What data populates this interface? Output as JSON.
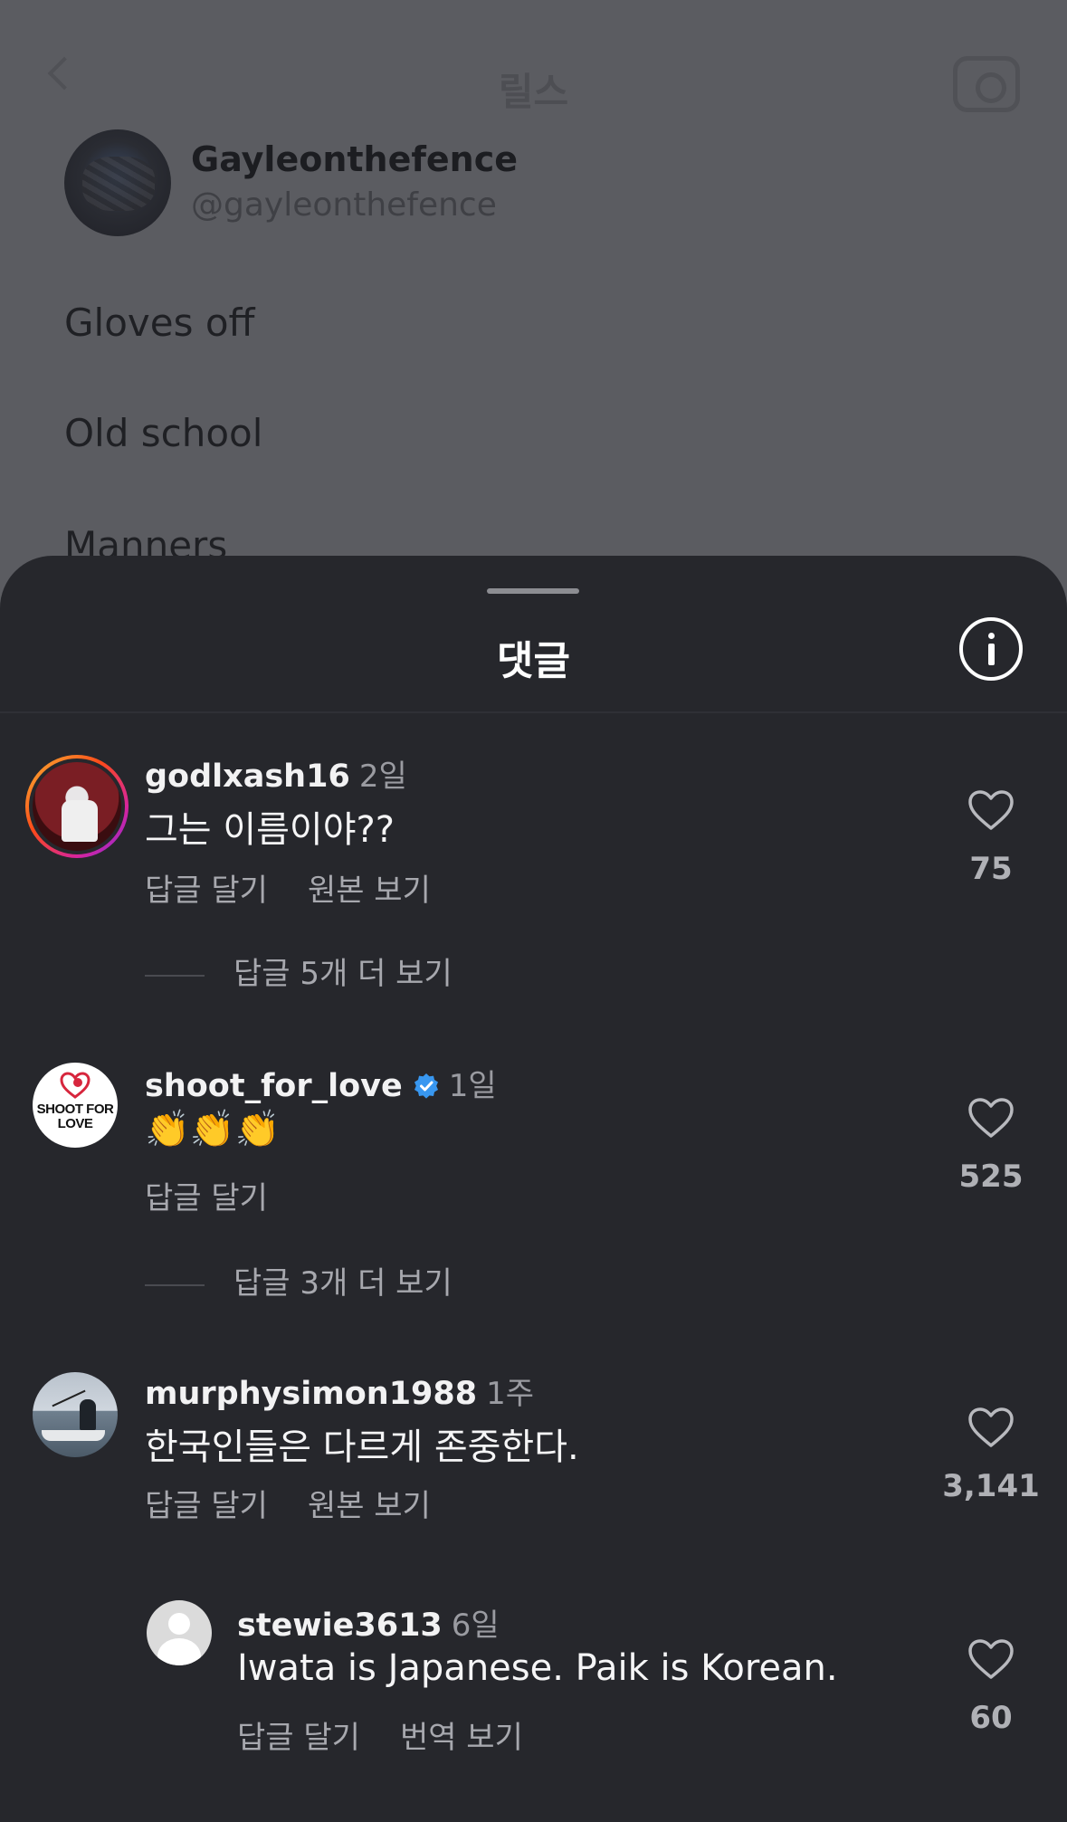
{
  "background": {
    "title": "릴스",
    "profile": {
      "name": "Gayleonthefence",
      "handle": "@gayleonthefence"
    },
    "lines": [
      "Gloves off",
      "Old school",
      "Manners"
    ]
  },
  "sheet": {
    "title": "댓글",
    "comments": [
      {
        "username": "godlxash16",
        "time": "2일",
        "text": "그는 이름이야??",
        "actions": [
          "답글 달기",
          "원본 보기"
        ],
        "likes": "75",
        "view_replies": "답글 5개 더 보기"
      },
      {
        "username": "shoot_for_love",
        "verified": true,
        "time": "1일",
        "text": "👏👏👏",
        "actions": [
          "답글 달기"
        ],
        "likes": "525",
        "view_replies": "답글 3개 더 보기",
        "avatar_logo": "SHOOT FOR LOVE"
      },
      {
        "username": "murphysimon1988",
        "time": "1주",
        "text": "한국인들은 다르게 존중한다.",
        "actions": [
          "답글 달기",
          "원본 보기"
        ],
        "likes": "3,141"
      },
      {
        "username": "stewie3613",
        "time": "6일",
        "text": "Iwata is Japanese. Paik is Korean.",
        "actions": [
          "답글 달기",
          "번역 보기"
        ],
        "likes": "60"
      }
    ]
  },
  "colors": {
    "sheet_bg": "#26272c",
    "dim_bg": "#5b5c61",
    "verified": "#3897f0",
    "muted_text": "#a7a8ae"
  },
  "icons": [
    "back-chevron-icon",
    "camera-icon",
    "info-icon",
    "heart-outline-icon",
    "verified-badge-icon",
    "default-avatar-icon"
  ]
}
